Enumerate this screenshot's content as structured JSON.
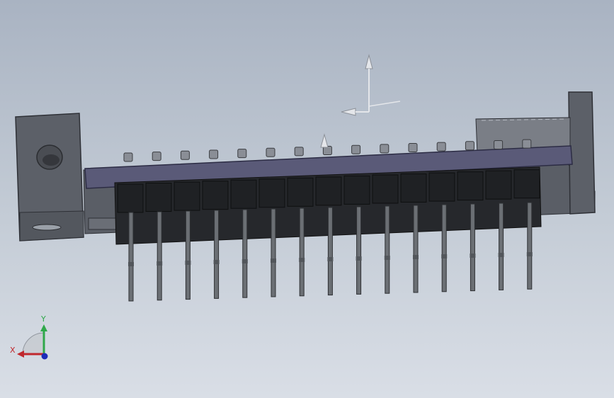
{
  "viewport": {
    "background_top": "#a9b3c2",
    "background_bottom": "#d9dee6"
  },
  "model": {
    "name": "pin-header-connector",
    "body_color": "#5b5f66",
    "strip_color": "#5a5a78",
    "pin_color": "#6b6f74",
    "pin_count": 15
  },
  "triad": {
    "x_label": "X",
    "y_label": "Y",
    "x_color": "#c0282d",
    "y_color": "#2fa84a",
    "z_color": "#1c2bb8"
  },
  "icons": {
    "origin_marker": "reference-origin-icon",
    "triad": "view-orientation-triad-icon"
  }
}
